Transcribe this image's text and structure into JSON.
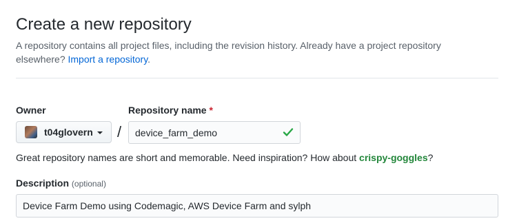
{
  "header": {
    "title": "Create a new repository",
    "description": "A repository contains all project files, including the revision history. Already have a project repository elsewhere?",
    "import_link": "Import a repository",
    "import_suffix": "."
  },
  "owner": {
    "label": "Owner",
    "name": "t04glovern",
    "avatar_icon": "user-avatar"
  },
  "separator": "/",
  "repository_name": {
    "label": "Repository name",
    "required_mark": "*",
    "value": "device_farm_demo",
    "status_icon": "check-icon",
    "status_color": "#28a745"
  },
  "hint": {
    "text": "Great repository names are short and memorable. Need inspiration? How about",
    "suggestion": "crispy-goggles",
    "suffix": "?"
  },
  "description": {
    "label": "Description",
    "optional_label": "(optional)",
    "value": "Device Farm Demo using Codemagic, AWS Device Farm and sylph"
  },
  "colors": {
    "link": "#0366d6",
    "suggestion": "#22863a",
    "required": "#cb2431"
  }
}
